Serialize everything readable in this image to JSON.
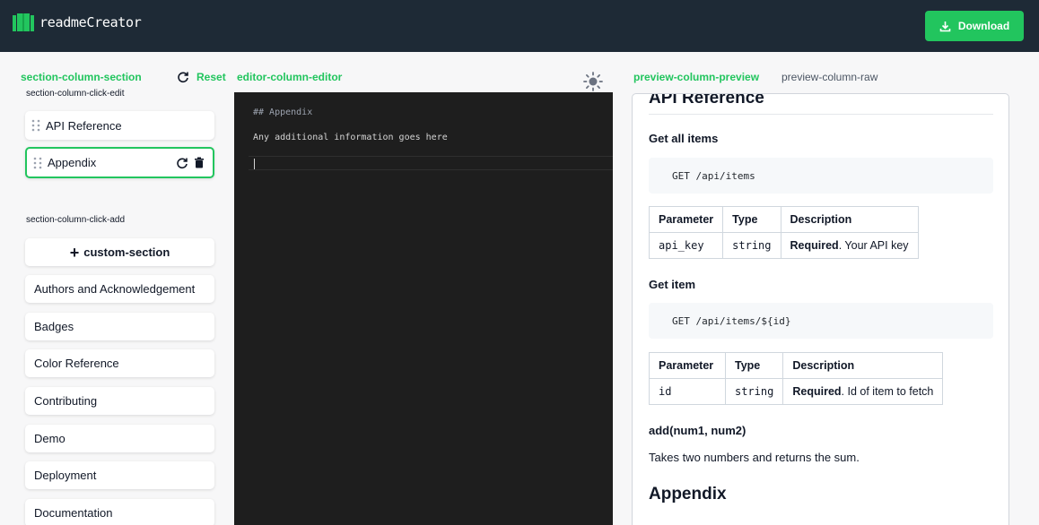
{
  "app": {
    "name": "readmeCreator",
    "download_label": "Download"
  },
  "sections": {
    "header_label": "section-column-section",
    "reset_label": "Reset",
    "click_edit_label": "section-column-click-edit",
    "selected": [
      {
        "label": "API Reference"
      },
      {
        "label": "Appendix"
      }
    ],
    "click_add_label": "section-column-click-add",
    "custom_section_label": "custom-section",
    "available": [
      {
        "label": "Authors and Acknowledgement"
      },
      {
        "label": "Badges"
      },
      {
        "label": "Color Reference"
      },
      {
        "label": "Contributing"
      },
      {
        "label": "Demo"
      },
      {
        "label": "Deployment"
      },
      {
        "label": "Documentation"
      }
    ]
  },
  "editor": {
    "header_label": "editor-column-editor",
    "lines": [
      "## Appendix",
      "Any additional information goes here"
    ]
  },
  "preview": {
    "tab_preview": "preview-column-preview",
    "tab_raw": "preview-column-raw",
    "api_heading": "API Reference",
    "get_all_title": "Get all items",
    "get_all_code": "GET /api/items",
    "get_item_title": "Get item",
    "get_item_code": "GET /api/items/${id}",
    "table_headers": [
      "Parameter",
      "Type",
      "Description"
    ],
    "table1_row": {
      "param": "api_key",
      "type": "string",
      "required": "Required",
      "desc": ". Your API key"
    },
    "table2_row": {
      "param": "id",
      "type": "string",
      "required": "Required",
      "desc": ". Id of item to fetch"
    },
    "func_title": "add(num1, num2)",
    "func_desc": "Takes two numbers and returns the sum.",
    "appendix_heading": "Appendix"
  },
  "colors": {
    "accent": "#22c55e",
    "topbar": "#1e2a36",
    "editor_bg": "#1e1e1e"
  }
}
